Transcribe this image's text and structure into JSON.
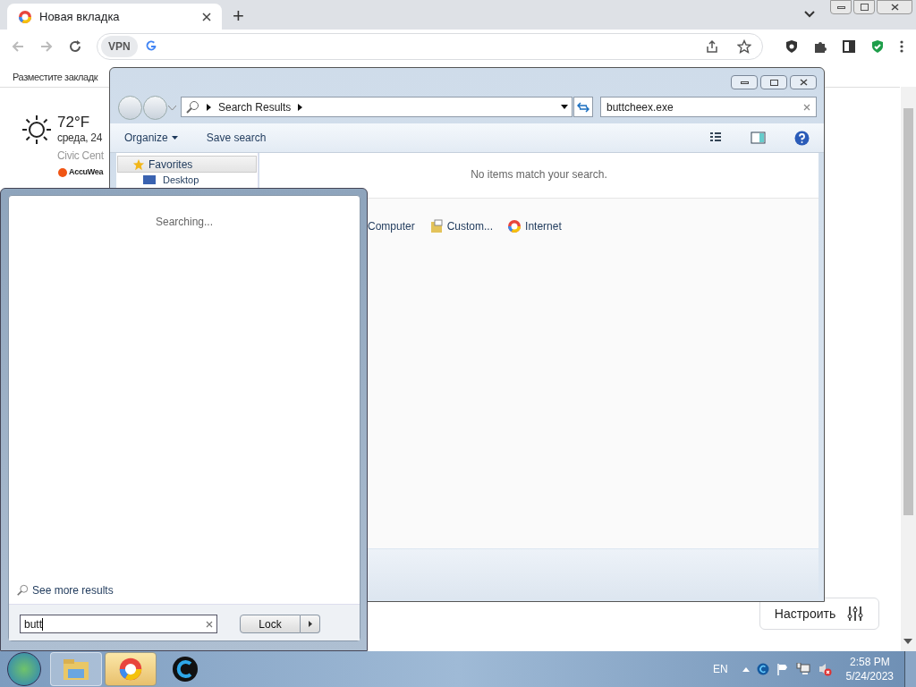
{
  "browser": {
    "tabs": [
      {
        "title": "Новая вкладка",
        "selected": true
      }
    ],
    "new_tab": "+",
    "bookmarks_hint": "Разместите закладк",
    "vpn_label": "VPN",
    "weather": {
      "temperature": "72°F",
      "date": "среда, 24",
      "location": "Civic Cent",
      "provider": "AccuWea"
    },
    "customize_button": "Настроить"
  },
  "explorer": {
    "address": "Search Results",
    "search_value": "buttcheex.exe",
    "toolbar": [
      "Organize",
      "Save search"
    ],
    "nav_items": [
      "Favorites",
      "Desktop"
    ],
    "message": "No items match your search.",
    "search_again": [
      {
        "label": "Computer",
        "kind": "plain"
      },
      {
        "label": "Custom...",
        "kind": "folder"
      },
      {
        "label": "Internet",
        "kind": "globe"
      }
    ]
  },
  "start_menu": {
    "status": "Searching...",
    "see_more": "See more results",
    "search_value": "butt",
    "shutdown_button": "Lock"
  },
  "taskbar": {
    "apps": [
      {
        "kind": "folder",
        "selected": false
      },
      {
        "kind": "browser",
        "selected": true
      },
      {
        "kind": "cleaner",
        "selected": false
      }
    ],
    "language": "EN",
    "time": "2:58 PM",
    "date": "5/24/2023"
  }
}
